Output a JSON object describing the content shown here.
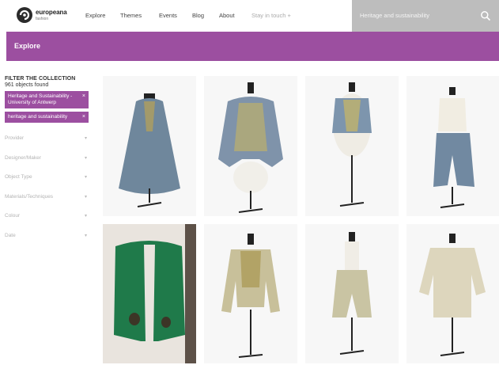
{
  "brand": {
    "name": "europeana",
    "sub": "fashion"
  },
  "nav": {
    "items": [
      "Explore",
      "Themes",
      "Events",
      "Blog",
      "About",
      "Stay in touch +"
    ],
    "search_value": "Heritage and sustainability"
  },
  "band": {
    "title": "Explore"
  },
  "sidebar": {
    "filter_title": "FILTER THE COLLECTION",
    "found": "961 objects found",
    "chips": [
      "Heritage and Sustainability - University of Antwerp",
      "heritage and sustainability"
    ],
    "facets": [
      "Provider",
      "Designer/Maker",
      "Object Type",
      "Materials/Techniques",
      "Colour",
      "Date"
    ]
  },
  "colors": {
    "accent": "#9c4fa0",
    "search_bg": "#bdbdbd"
  },
  "grid": {
    "items": [
      {
        "name": "grey-cape",
        "garment": "cape",
        "color": "#6f879c",
        "bg": "#f7f7f7"
      },
      {
        "name": "grey-embroidered-jacket",
        "garment": "jacket",
        "color": "#7f93aa",
        "bg": "#f7f7f7"
      },
      {
        "name": "blue-embroidered-vest",
        "garment": "vest",
        "color": "#7d95ad",
        "bg": "#f7f7f7"
      },
      {
        "name": "blouse-and-blue-trousers",
        "garment": "outfit",
        "color": "#7189a1",
        "bg": "#f7f7f7"
      },
      {
        "name": "green-jacket",
        "garment": "green",
        "color": "#1f7a4a",
        "bg": "#e9e4de"
      },
      {
        "name": "striped-jacket",
        "garment": "striped",
        "color": "#c8c09a",
        "bg": "#f7f7f7"
      },
      {
        "name": "pale-trousers",
        "garment": "trousers",
        "color": "#c9c4a3",
        "bg": "#f7f7f7"
      },
      {
        "name": "cream-blouse",
        "garment": "blouse",
        "color": "#ddd6bd",
        "bg": "#f7f7f7"
      }
    ]
  }
}
